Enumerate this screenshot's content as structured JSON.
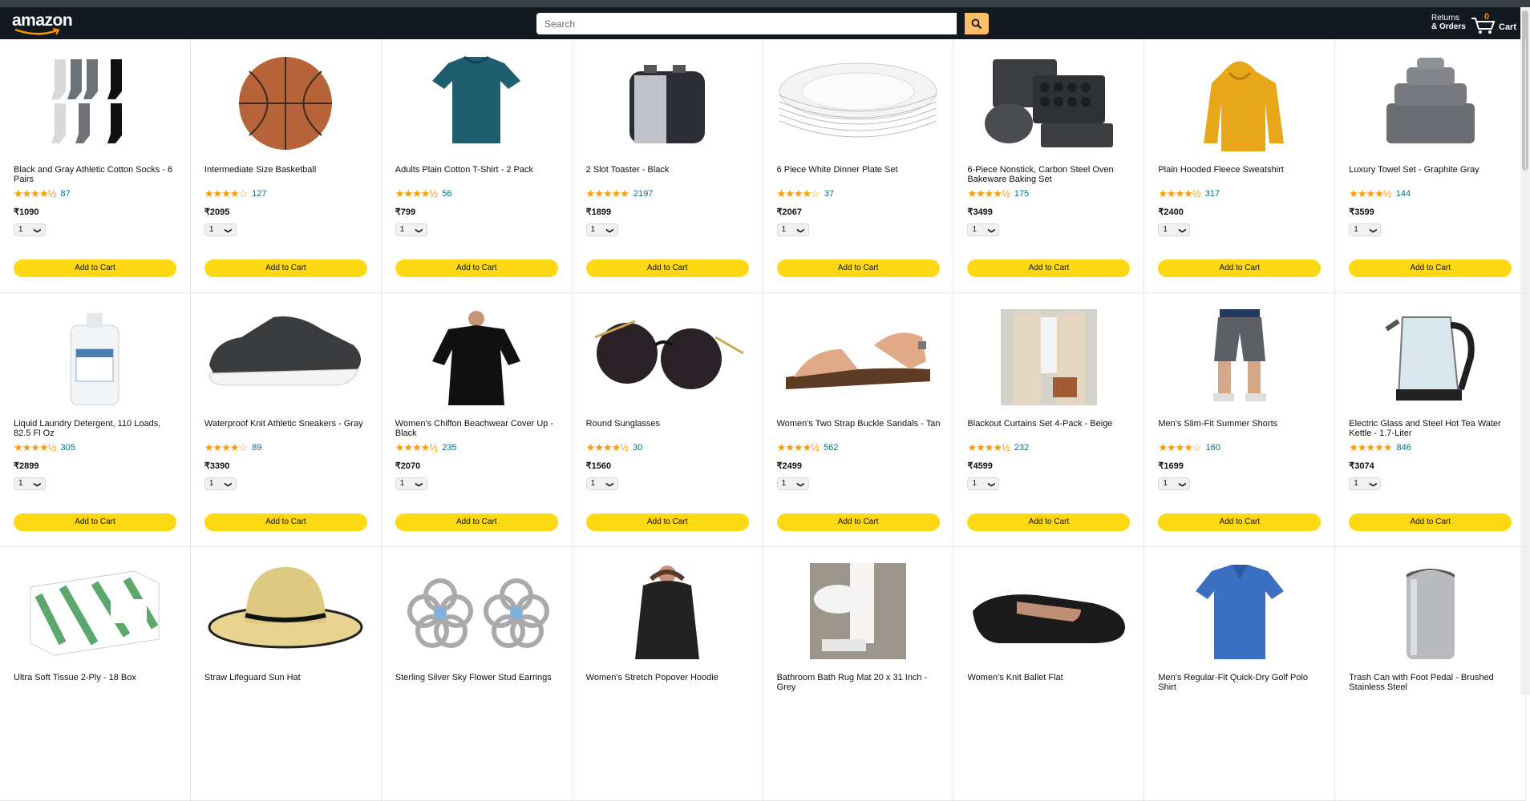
{
  "header": {
    "logo_text": "amazon",
    "search_placeholder": "Search",
    "returns_line1": "Returns",
    "returns_line2": "& Orders",
    "cart_count": "0",
    "cart_label": "Cart"
  },
  "colors": {
    "header_bg": "#131921",
    "star": "#ff9900",
    "button": "#ffd814",
    "link": "#007185"
  },
  "products": [
    {
      "title": "Black and Gray Athletic Cotton Socks - 6 Pairs",
      "stars": "★★★★½",
      "count": "87",
      "price": "₹1090",
      "qty": "1",
      "button": "Add to Cart",
      "icon": "socks-image"
    },
    {
      "title": "Intermediate Size Basketball",
      "stars": "★★★★☆",
      "count": "127",
      "price": "₹2095",
      "qty": "1",
      "button": "Add to Cart",
      "icon": "basketball-image"
    },
    {
      "title": "Adults Plain Cotton T-Shirt - 2 Pack",
      "stars": "★★★★½",
      "count": "56",
      "price": "₹799",
      "qty": "1",
      "button": "Add to Cart",
      "icon": "tshirt-image"
    },
    {
      "title": "2 Slot Toaster - Black",
      "stars": "★★★★★",
      "count": "2197",
      "price": "₹1899",
      "qty": "1",
      "button": "Add to Cart",
      "icon": "toaster-image"
    },
    {
      "title": "6 Piece White Dinner Plate Set",
      "stars": "★★★★☆",
      "count": "37",
      "price": "₹2067",
      "qty": "1",
      "button": "Add to Cart",
      "icon": "plates-image"
    },
    {
      "title": "6-Piece Nonstick, Carbon Steel Oven Bakeware Baking Set",
      "stars": "★★★★½",
      "count": "175",
      "price": "₹3499",
      "qty": "1",
      "button": "Add to Cart",
      "icon": "bakeware-image"
    },
    {
      "title": "Plain Hooded Fleece Sweatshirt",
      "stars": "★★★★½",
      "count": "317",
      "price": "₹2400",
      "qty": "1",
      "button": "Add to Cart",
      "icon": "hoodie-image"
    },
    {
      "title": "Luxury Towel Set - Graphite Gray",
      "stars": "★★★★½",
      "count": "144",
      "price": "₹3599",
      "qty": "1",
      "button": "Add to Cart",
      "icon": "towels-image"
    },
    {
      "title": "Liquid Laundry Detergent, 110 Loads, 82.5 Fl Oz",
      "stars": "★★★★½",
      "count": "305",
      "price": "₹2899",
      "qty": "1",
      "button": "Add to Cart",
      "icon": "detergent-image"
    },
    {
      "title": "Waterproof Knit Athletic Sneakers - Gray",
      "stars": "★★★★☆",
      "count": "89",
      "price": "₹3390",
      "qty": "1",
      "button": "Add to Cart",
      "icon": "sneaker-image"
    },
    {
      "title": "Women's Chiffon Beachwear Cover Up - Black",
      "stars": "★★★★½",
      "count": "235",
      "price": "₹2070",
      "qty": "1",
      "button": "Add to Cart",
      "icon": "coverup-image"
    },
    {
      "title": "Round Sunglasses",
      "stars": "★★★★½",
      "count": "30",
      "price": "₹1560",
      "qty": "1",
      "button": "Add to Cart",
      "icon": "sunglasses-image"
    },
    {
      "title": "Women's Two Strap Buckle Sandals - Tan",
      "stars": "★★★★½",
      "count": "562",
      "price": "₹2499",
      "qty": "1",
      "button": "Add to Cart",
      "icon": "sandal-image"
    },
    {
      "title": "Blackout Curtains Set 4-Pack - Beige",
      "stars": "★★★★½",
      "count": "232",
      "price": "₹4599",
      "qty": "1",
      "button": "Add to Cart",
      "icon": "curtains-image"
    },
    {
      "title": "Men's Slim-Fit Summer Shorts",
      "stars": "★★★★☆",
      "count": "160",
      "price": "₹1699",
      "qty": "1",
      "button": "Add to Cart",
      "icon": "shorts-image"
    },
    {
      "title": "Electric Glass and Steel Hot Tea Water Kettle - 1.7-Liter",
      "stars": "★★★★★",
      "count": "846",
      "price": "₹3074",
      "qty": "1",
      "button": "Add to Cart",
      "icon": "kettle-image"
    },
    {
      "title": "Ultra Soft Tissue 2-Ply - 18 Box",
      "icon": "tissue-box-image"
    },
    {
      "title": "Straw Lifeguard Sun Hat",
      "icon": "sun-hat-image"
    },
    {
      "title": "Sterling Silver Sky Flower Stud Earrings",
      "icon": "earrings-image"
    },
    {
      "title": "Women's Stretch Popover Hoodie",
      "icon": "popover-hoodie-image"
    },
    {
      "title": "Bathroom Bath Rug Mat 20 x 31 Inch - Grey",
      "icon": "bath-mat-image"
    },
    {
      "title": "Women's Knit Ballet Flat",
      "icon": "ballet-flat-image"
    },
    {
      "title": "Men's Regular-Fit Quick-Dry Golf Polo Shirt",
      "icon": "polo-shirt-image"
    },
    {
      "title": "Trash Can with Foot Pedal - Brushed Stainless Steel",
      "icon": "trash-can-image"
    }
  ]
}
